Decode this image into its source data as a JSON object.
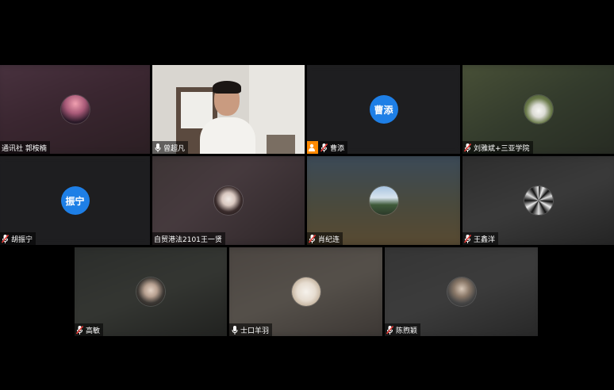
{
  "participants": [
    {
      "id": "p1",
      "name": "通讯社 郭桉楠",
      "mic": "none"
    },
    {
      "id": "p2",
      "name": "曾超凡",
      "mic": "on",
      "video": true
    },
    {
      "id": "p3",
      "name": "曹添",
      "mic": "muted",
      "initials": "曹添",
      "badge": "person-icon"
    },
    {
      "id": "p4",
      "name": "刘雅斌+三亚学院",
      "mic": "muted"
    },
    {
      "id": "p5",
      "name": "胡振宁",
      "mic": "muted",
      "initials": "振宁"
    },
    {
      "id": "p6",
      "name": "自贸港法2101王一贤",
      "mic": "none"
    },
    {
      "id": "p7",
      "name": "肖纪连",
      "mic": "muted"
    },
    {
      "id": "p8",
      "name": "王鑫洋",
      "mic": "muted"
    },
    {
      "id": "p9",
      "name": "高敏",
      "mic": "muted"
    },
    {
      "id": "p10",
      "name": "士口羊羽",
      "mic": "on"
    },
    {
      "id": "p11",
      "name": "陈煦颖",
      "mic": "muted"
    }
  ],
  "colors": {
    "active_border": "#25b35a",
    "initials_bg": "#1e7fe6",
    "muted_red": "#e53935",
    "badge_orange": "#ff8a00"
  }
}
